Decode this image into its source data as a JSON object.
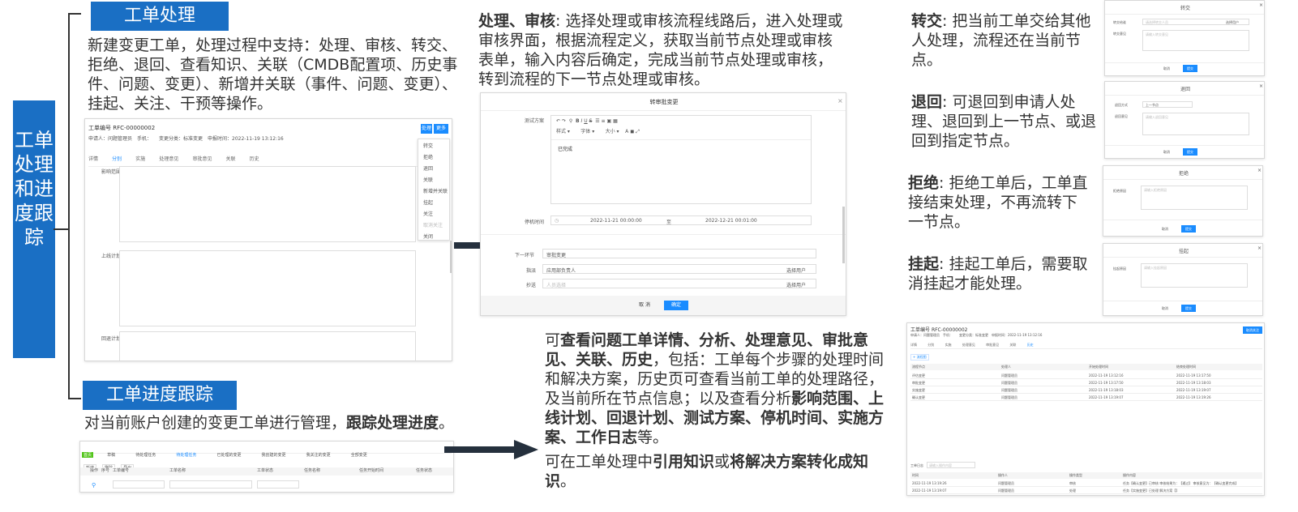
{
  "vertical_title": "工单处理和进度跟踪",
  "section1": {
    "tag": "工单处理",
    "desc": "新建变更工单，处理过程中支持：处理、审核、转交、拒绝、退回、查看知识、关联（CMDB配置项、历史事件、问题、变更）、新增并关联（事件、问题、变更）、挂起、关注、干预等操作。"
  },
  "section2": {
    "tag": "工单进度跟踪",
    "desc_prefix": "对当前账户创建的变更工单进行管理，",
    "desc_bold": "跟踪处理进度",
    "desc_suffix": "。"
  },
  "ticket_shot": {
    "id_label": "工单编号",
    "id_value": "RFC-00000002",
    "meta": "申请人：问题管理员　手机：　　变更分类：标准变更　申报时间：2022-11-19 13:12:16",
    "tabs": [
      "详情",
      "分别",
      "实施",
      "处理意见",
      "审批意见",
      "关联",
      "历史"
    ],
    "btn_handle": "处理",
    "btn_more": "更多",
    "menu": [
      "转交",
      "拒绝",
      "退回",
      "关联",
      "新增并关联",
      "挂起",
      "关注",
      "取消关注",
      "关闭"
    ],
    "field1": "影响范围",
    "field2": "上线计划",
    "field3": "回退计划"
  },
  "dialog_shot": {
    "title": "转审批变更",
    "label_test": "测试方案",
    "editor_text": "已完成",
    "style_label": "样式",
    "font_label": "字体",
    "size_label": "大小",
    "label_downtime": "停机时间",
    "time_start": "2022-11-21 00:00:00",
    "time_to": "至",
    "time_end": "2022-12-21 00:01:00",
    "label_next": "下一环节",
    "next_value": "审批变更",
    "label_handler": "指派",
    "handler_value": "应用部负责人",
    "label_cc": "抄送",
    "cc_placeholder": "人员选择",
    "select_user": "选择用户",
    "btn_cancel": "取 消",
    "btn_ok": "确定"
  },
  "process_text": {
    "bold": "处理、审核",
    "rest": ": 选择处理或审核流程线路后，进入处理或审核界面，根据流程定义，获取当前节点处理或审核表单，输入内容后确定，完成当前节点处理或审核，转到流程的下一节点处理或审核。"
  },
  "transfer": {
    "bold": "转交",
    "rest": ": 把当前工单交给其他人处理，流程还在当前节点。",
    "shot_title": "转交",
    "label1": "转交给谁",
    "label2": "转交意见",
    "placeholder1": "请选择转交人员",
    "placeholder2": "请输入转交意见",
    "btn_select": "选择用户",
    "btn_cancel": "取消",
    "btn_ok": "提交"
  },
  "return": {
    "bold": "退回",
    "rest": ": 可退回到申请人处理、退回到上一节点、或退回到指定节点。",
    "shot_title": "退回",
    "label1": "退回方式",
    "label2": "退回意见",
    "select_value": "上一节点",
    "placeholder2": "请输入退回意见",
    "btn_cancel": "取消",
    "btn_ok": "提交"
  },
  "reject": {
    "bold": "拒绝",
    "rest": ": 拒绝工单后，工单直接结束处理，不再流转下一节点。",
    "shot_title": "拒绝",
    "label1": "拒绝原因",
    "placeholder": "请输入拒绝原因",
    "btn_cancel": "取消",
    "btn_ok": "提交"
  },
  "suspend": {
    "bold": "挂起",
    "rest": ": 挂起工单后，需要取消挂起才能处理。",
    "shot_title": "挂起",
    "label1": "挂起原因",
    "placeholder": "请输入挂起原因",
    "btn_cancel": "取消",
    "btn_ok": "提交"
  },
  "detail_text": {
    "p1_pre": "可",
    "p1_bold": "查看问题工单详情、分析、处理意见、审批意见、关联、历史",
    "p1_mid": "，包括：工单每个步骤的处理时间和解决方案，历史页可查看当前工单的处理路径，及当前所在节点信息；以及查看分析",
    "p1_bold2": "影响范围、上线计划、回退计划、测试方案、停机时间、实施方案、工作日志",
    "p1_end": "等。",
    "p2_pre": "可在工单处理中",
    "p2_bold": "引用知识",
    "p2_mid": "或",
    "p2_bold2": "将解决方案转化成知识",
    "p2_end": "。"
  },
  "list_shot": {
    "tabs": [
      "首页",
      "草稿",
      "待处理任务",
      "待处理任务",
      "已处理的变更",
      "我创建的变更",
      "我关注的变更",
      "全部变更"
    ],
    "toolbar": [
      "新增",
      "删除",
      "导出"
    ],
    "columns": [
      "操作",
      "序号",
      "工单编号",
      "工单名称",
      "工单状态",
      "任务名称",
      "任务开始时间",
      "任务状态"
    ]
  },
  "history_shot": {
    "id_label": "工单编号",
    "id_value": "RFC-00000002",
    "meta": "申请人：问题管理员　手机：　　变更分类：标准变更　申报时间：2022-11-19 13:12:16",
    "btn": "取消关注",
    "tabs": [
      "详情",
      "分别",
      "实施",
      "处理意见",
      "审批意见",
      "关联",
      "历史"
    ],
    "flow_btn": "流程图",
    "cols1": [
      "流程节点",
      "处理人",
      "开始处理时间",
      "结束处理时间"
    ],
    "rows1": [
      [
        "评估变更",
        "问题管理员",
        "2022-11-19 13:12:16",
        "2022-11-19 13:17:50"
      ],
      [
        "审批变更",
        "问题管理员",
        "2022-11-19 13:17:50",
        "2022-11-19 13:18:03"
      ],
      [
        "实施变更",
        "问题管理员",
        "2022-11-19 13:18:03",
        "2022-11-19 13:19:07"
      ],
      [
        "确认变更",
        "问题管理员",
        "2022-11-19 13:19:07",
        "2022-11-19 13:19:26"
      ]
    ],
    "log_label": "工单日志",
    "log_placeholder": "请输入操作内容",
    "cols2": [
      "时间",
      "操作人",
      "操作类型",
      "操作内容"
    ],
    "rows2": [
      [
        "2022-11-19 13:19:26",
        "问题管理员",
        "审核",
        "任务【确认变更】已审核 审核结果为：【通过】 审核意见为：【确认变更完成】"
      ],
      [
        "2022-11-19 13:19:07",
        "问题管理员",
        "处理",
        "任务【实施变更】已处理 解决方案【】"
      ]
    ]
  }
}
